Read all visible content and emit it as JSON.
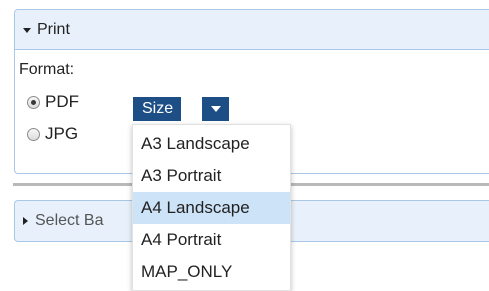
{
  "print_panel": {
    "title": "Print",
    "format_label": "Format:",
    "options": [
      {
        "label": "PDF",
        "checked": true
      },
      {
        "label": "JPG",
        "checked": false
      }
    ],
    "size_button_label": "Size"
  },
  "select_panel": {
    "title": "Select Ba"
  },
  "size_menu": {
    "items": [
      "A3 Landscape",
      "A3 Portrait",
      "A4 Landscape",
      "A4 Portrait",
      "MAP_ONLY"
    ],
    "highlighted": "A4 Landscape"
  },
  "colors": {
    "header_bg": "#e8f1fb",
    "button_bg": "#1d4e86",
    "highlight": "#cce3f8"
  }
}
